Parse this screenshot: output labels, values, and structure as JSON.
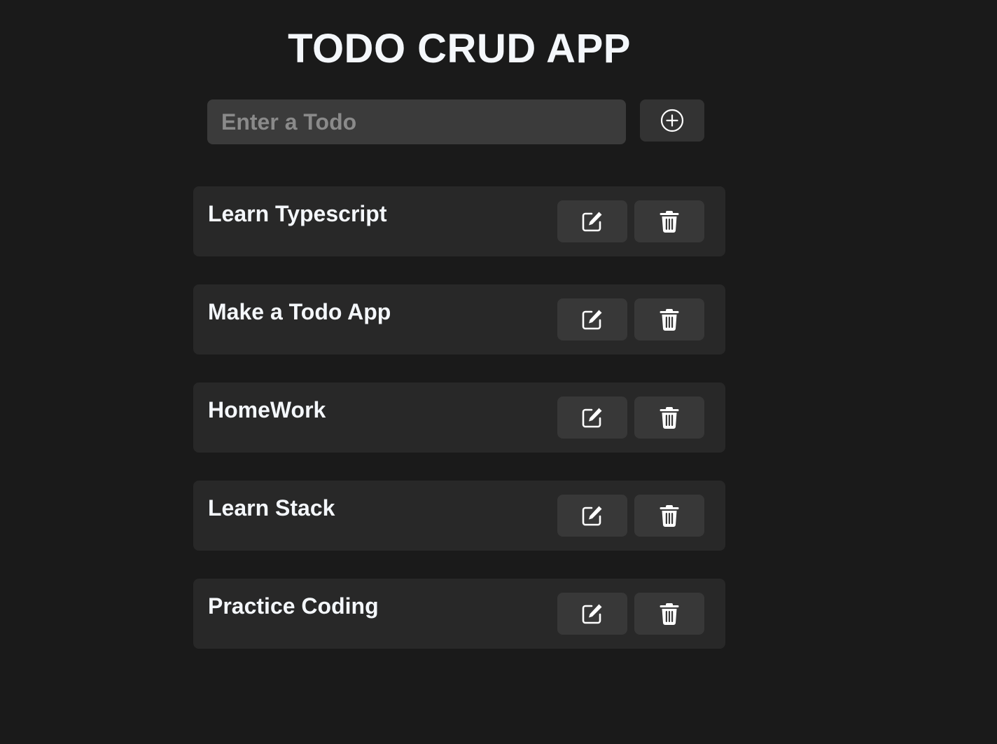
{
  "app": {
    "title": "TODO CRUD APP"
  },
  "input": {
    "placeholder": "Enter a Todo",
    "value": ""
  },
  "add_button": {
    "icon": "plus-circle-icon"
  },
  "todos": [
    {
      "text": "Learn Typescript",
      "edit_icon": "edit-icon",
      "delete_icon": "trash-icon"
    },
    {
      "text": "Make a Todo App",
      "edit_icon": "edit-icon",
      "delete_icon": "trash-icon"
    },
    {
      "text": "HomeWork",
      "edit_icon": "edit-icon",
      "delete_icon": "trash-icon"
    },
    {
      "text": "Learn Stack",
      "edit_icon": "edit-icon",
      "delete_icon": "trash-icon"
    },
    {
      "text": "Practice Coding",
      "edit_icon": "edit-icon",
      "delete_icon": "trash-icon"
    }
  ],
  "colors": {
    "background": "#1a1a1a",
    "input_bg": "#3b3b3b",
    "card_bg": "#282828",
    "button_bg": "#383838",
    "text": "#f4f7fb"
  }
}
